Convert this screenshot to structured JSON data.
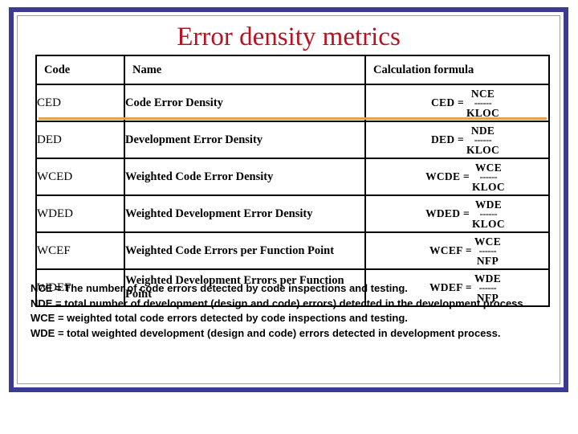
{
  "slide": {
    "title": "Error density metrics",
    "title_color": "#b71122",
    "frame_color": "#3b3b8f",
    "header_fill": "#ccf8cc",
    "rule_color": "#e0a050"
  },
  "table": {
    "headers": [
      "Code",
      "Name",
      "Calculation formula"
    ],
    "rows": [
      {
        "code": "CED",
        "name": "Code Error Density",
        "formula": {
          "lhs": "CED =",
          "numerator": "NCE",
          "bar": "------",
          "denominator": "KLOC"
        },
        "highlighted": true
      },
      {
        "code": "DED",
        "name": "Development Error Density",
        "formula": {
          "lhs": "DED =",
          "numerator": "NDE",
          "bar": "------",
          "denominator": "KLOC"
        },
        "highlighted": false
      },
      {
        "code": "WCED",
        "name": "Weighted Code Error Density",
        "formula": {
          "lhs": "WCDE =",
          "numerator": "WCE",
          "bar": "------",
          "denominator": "KLOC"
        },
        "highlighted": false
      },
      {
        "code": "WDED",
        "name": "Weighted Development Error Density",
        "formula": {
          "lhs": "WDED =",
          "numerator": "WDE",
          "bar": "------",
          "denominator": "KLOC"
        },
        "highlighted": false
      },
      {
        "code": "WCEF",
        "name": "Weighted Code Errors per Function Point",
        "formula": {
          "lhs": "WCEF =",
          "numerator": "WCE",
          "bar": "------",
          "denominator": "NFP"
        },
        "highlighted": false
      },
      {
        "code": "WDEF",
        "name": "Weighted Development Errors per Function Point",
        "formula": {
          "lhs": "WDEF =",
          "numerator": "WDE",
          "bar": "------",
          "denominator": "NFP"
        },
        "highlighted": false
      }
    ]
  },
  "footnotes": [
    "NCE = The number of code errors detected by code inspections and testing.",
    "NDE = total number of development (design and code) errors) detected in the development process.",
    "WCE = weighted total code errors detected by code inspections and testing.",
    "WDE = total weighted development (design and code) errors detected in development process."
  ]
}
